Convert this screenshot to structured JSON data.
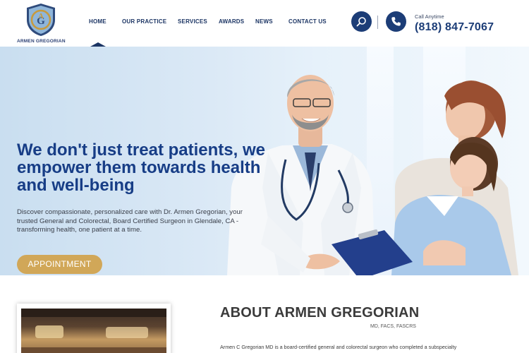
{
  "header": {
    "logo_text": "ARMEN GREGORIAN",
    "logo_letters": "AG",
    "nav": [
      "HOME",
      "OUR PRACTICE",
      "SERVICES",
      "AWARDS",
      "NEWS",
      "CONTACT US"
    ],
    "active_nav": "HOME",
    "search_icon": "search-icon",
    "phone_icon": "phone-icon",
    "call_label": "Call Anytime",
    "phone_number": "(818) 847-7067"
  },
  "hero": {
    "headline": "We don't just treat patients, we empower them towards health and well-being",
    "description": "Discover compassionate, personalized care with Dr. Armen Gregorian, your trusted General and Colorectal, Board Certified Surgeon in Glendale, CA - transforming health, one patient at a time.",
    "button_label": "APPOINTMENT"
  },
  "about": {
    "title": "ABOUT ARMEN GREGORIAN",
    "credentials": "MD, FACS, FASCRS",
    "text": "Armen C Gregorian MD is a board-certified general and colorectal surgeon who completed a subspecialty"
  },
  "colors": {
    "navy": "#1c3d77",
    "headline_blue": "#173d86",
    "gold": "#d1a758"
  }
}
